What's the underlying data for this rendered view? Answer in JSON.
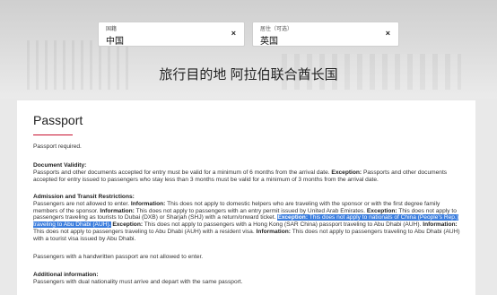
{
  "nationality": {
    "label": "国籍",
    "value": "中国",
    "clear": "×"
  },
  "residence": {
    "label": "居住（可选）",
    "value": "英国",
    "clear": "×"
  },
  "destination": "旅行目的地 阿拉伯联合酋长国",
  "card": {
    "title": "Passport",
    "required": "Passport required.",
    "validity_heading": "Document Validity:",
    "validity_text": "Passports and other documents accepted for entry must be valid for a minimum of 6 months from the arrival date.",
    "validity_exc_label": "Exception:",
    "validity_exc_text": "Passports and other documents accepted for entry issued to passengers who stay less than 3 months must be valid for a minimum of 3 months from the arrival date.",
    "admission_heading": "Admission and Transit Restrictions:",
    "adm_1": "Passengers are not allowed to enter.",
    "adm_info_label": "Information:",
    "adm_2": "This does not apply to domestic helpers who are traveling with the sponsor or with the first degree family members of the sponsor.",
    "adm_3": "This does not apply to passengers with an entry permit issued by United Arab Emirates.",
    "adm_exc_label": "Exception:",
    "adm_4": "This does not apply to passengers traveling as tourists to Dubai (DXB) or Sharjah (SHJ) with a return/onward ticket.",
    "adm_hl_label": "Exception:",
    "adm_hl_1": "This does not apply to nationals of China (People's Rep.)",
    "adm_hl_2": "traveling to Abu Dhabi (AUH).",
    "adm_5": "This does not apply to passengers with a Hong Kong (SAR China) passport traveling to Abu Dhabi (AUH).",
    "adm_6": "This does not apply to passengers traveling to Abu Dhabi (AUH) with a resident visa.",
    "adm_7": "This does not apply to passengers traveling to Abu Dhabi (AUH) with a tourist visa issued by Abu Dhabi.",
    "handwritten": "Passengers with a handwritten passport are not allowed to enter.",
    "additional_heading": "Additional information:",
    "additional_text": "Passengers with dual nationality must arrive and depart with the same passport."
  }
}
